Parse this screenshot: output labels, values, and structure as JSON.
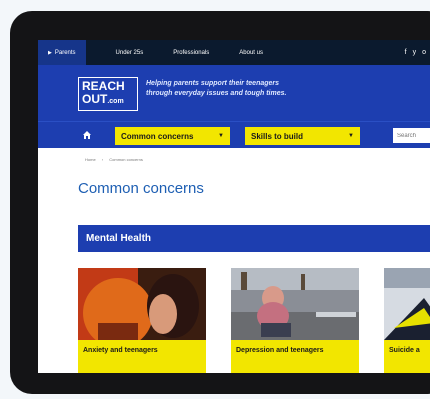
{
  "topnav": {
    "tabs": [
      {
        "label": "Parents",
        "active": true
      },
      {
        "label": "Under 25s"
      },
      {
        "label": "Professionals"
      },
      {
        "label": "About us"
      }
    ],
    "socials": [
      "f",
      "y",
      "o"
    ]
  },
  "header": {
    "logo_line1": "REACH",
    "logo_line2": "OUT",
    "logo_suffix": ".com",
    "tagline": "Helping parents support their teenagers through everyday issues and tough times."
  },
  "navbar": {
    "home_icon": "home-icon",
    "dropdown1": "Common concerns",
    "dropdown2": "Skills to build",
    "search_placeholder": "Search"
  },
  "breadcrumb": {
    "home": "Home",
    "separator": "›",
    "current": "Common concerns"
  },
  "page": {
    "title": "Common concerns"
  },
  "section": {
    "title": "Mental Health"
  },
  "cards": [
    {
      "label": "Anxiety and teenagers"
    },
    {
      "label": "Depression and teenagers"
    },
    {
      "label": "Suicide a"
    }
  ],
  "colors": {
    "brand_blue": "#1d3eb0",
    "accent_yellow": "#f2e600",
    "title_blue": "#1e5fb3",
    "dark_nav": "#0b1a2e"
  }
}
